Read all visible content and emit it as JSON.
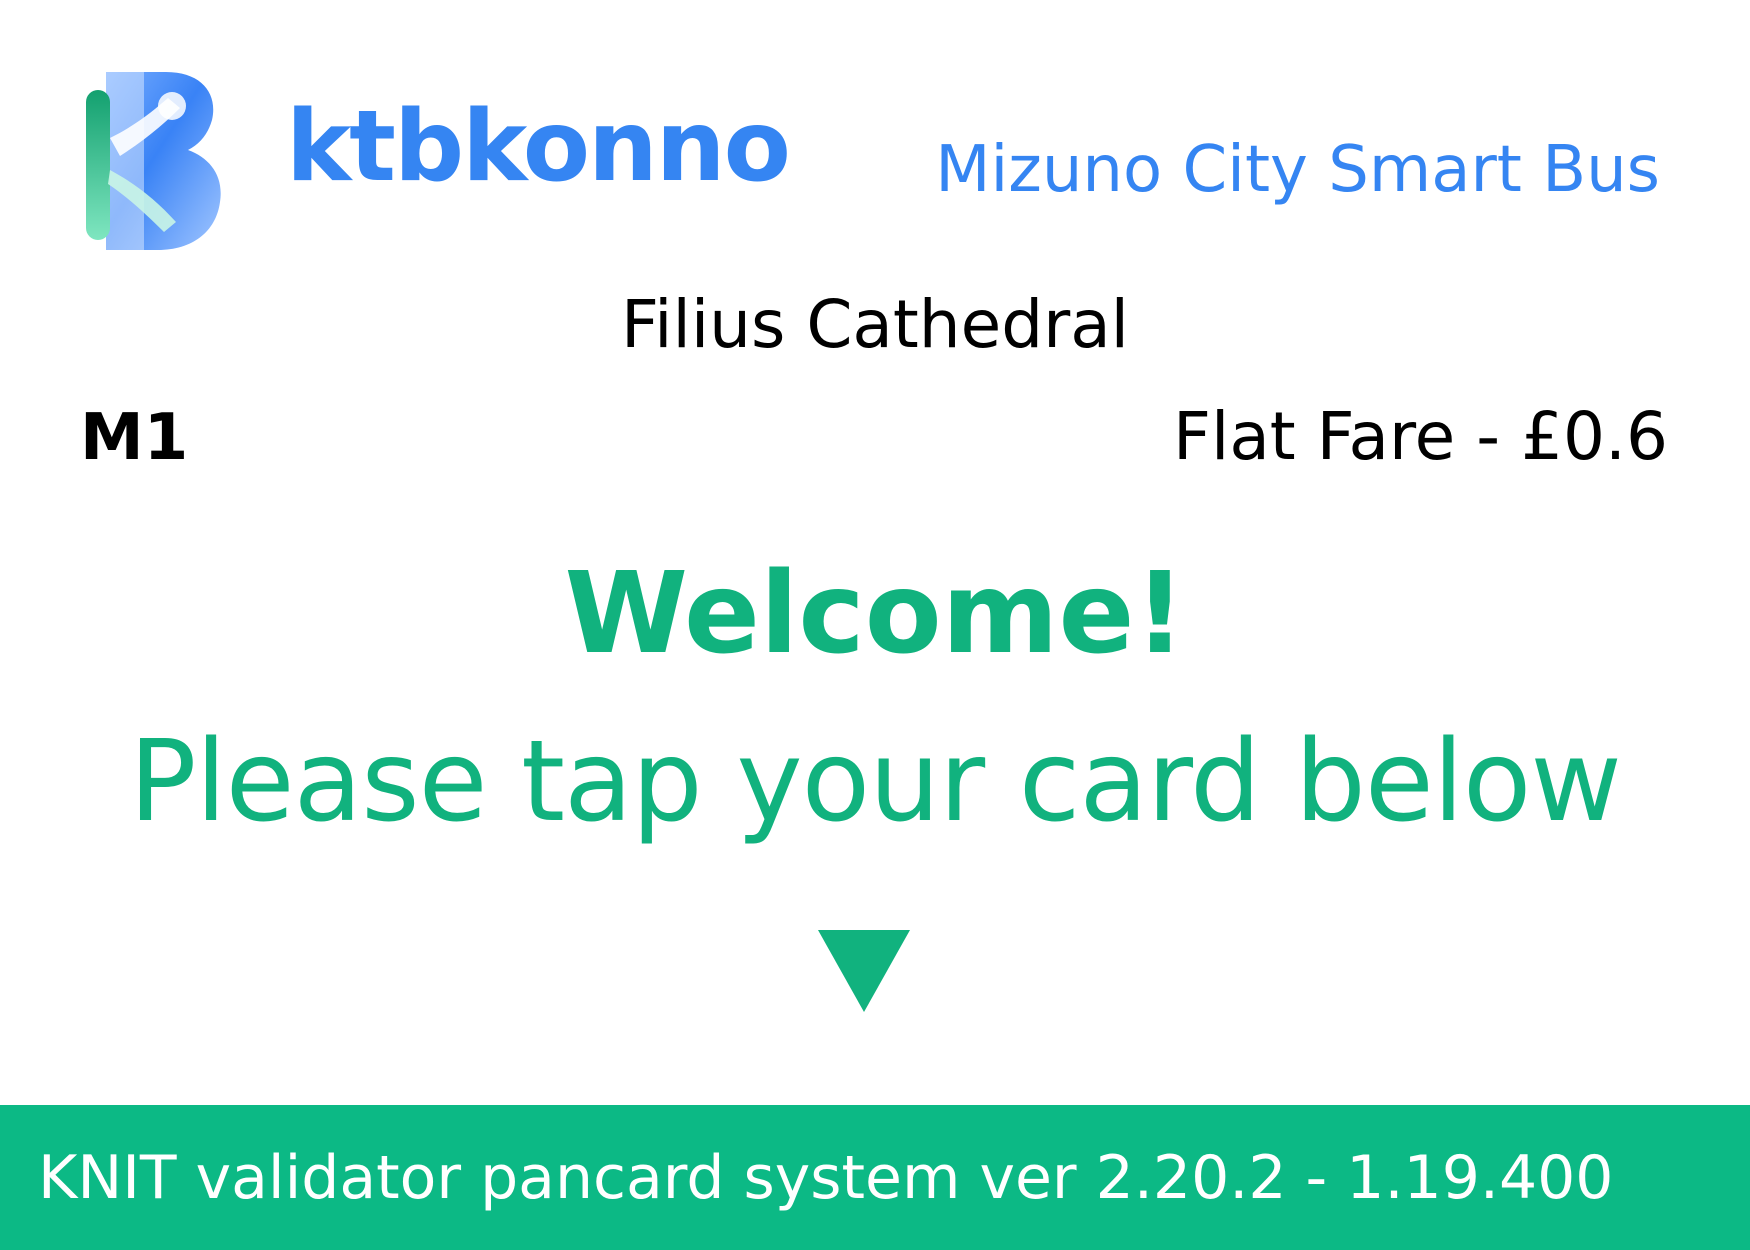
{
  "header": {
    "logo_icon": "ktbkonno-b-logo-icon",
    "brand_name": "ktbkonno",
    "subtitle": "Mizuno City Smart Bus"
  },
  "trip": {
    "stop_name": "Filius Cathedral",
    "route": "M1",
    "fare": "Flat Fare - £0.6"
  },
  "prompt": {
    "welcome": "Welcome!",
    "instruction": "Please tap your card below",
    "arrow_icon": "down-triangle-icon"
  },
  "footer": {
    "text": "KNIT validator pancard system ver 2.20.2 - 1.19.400"
  },
  "colors": {
    "brand_blue": "#3585f2",
    "accent_green": "#11b27e",
    "footer_green": "#0cb985",
    "text_black": "#000000",
    "footer_text": "#ffffff"
  }
}
